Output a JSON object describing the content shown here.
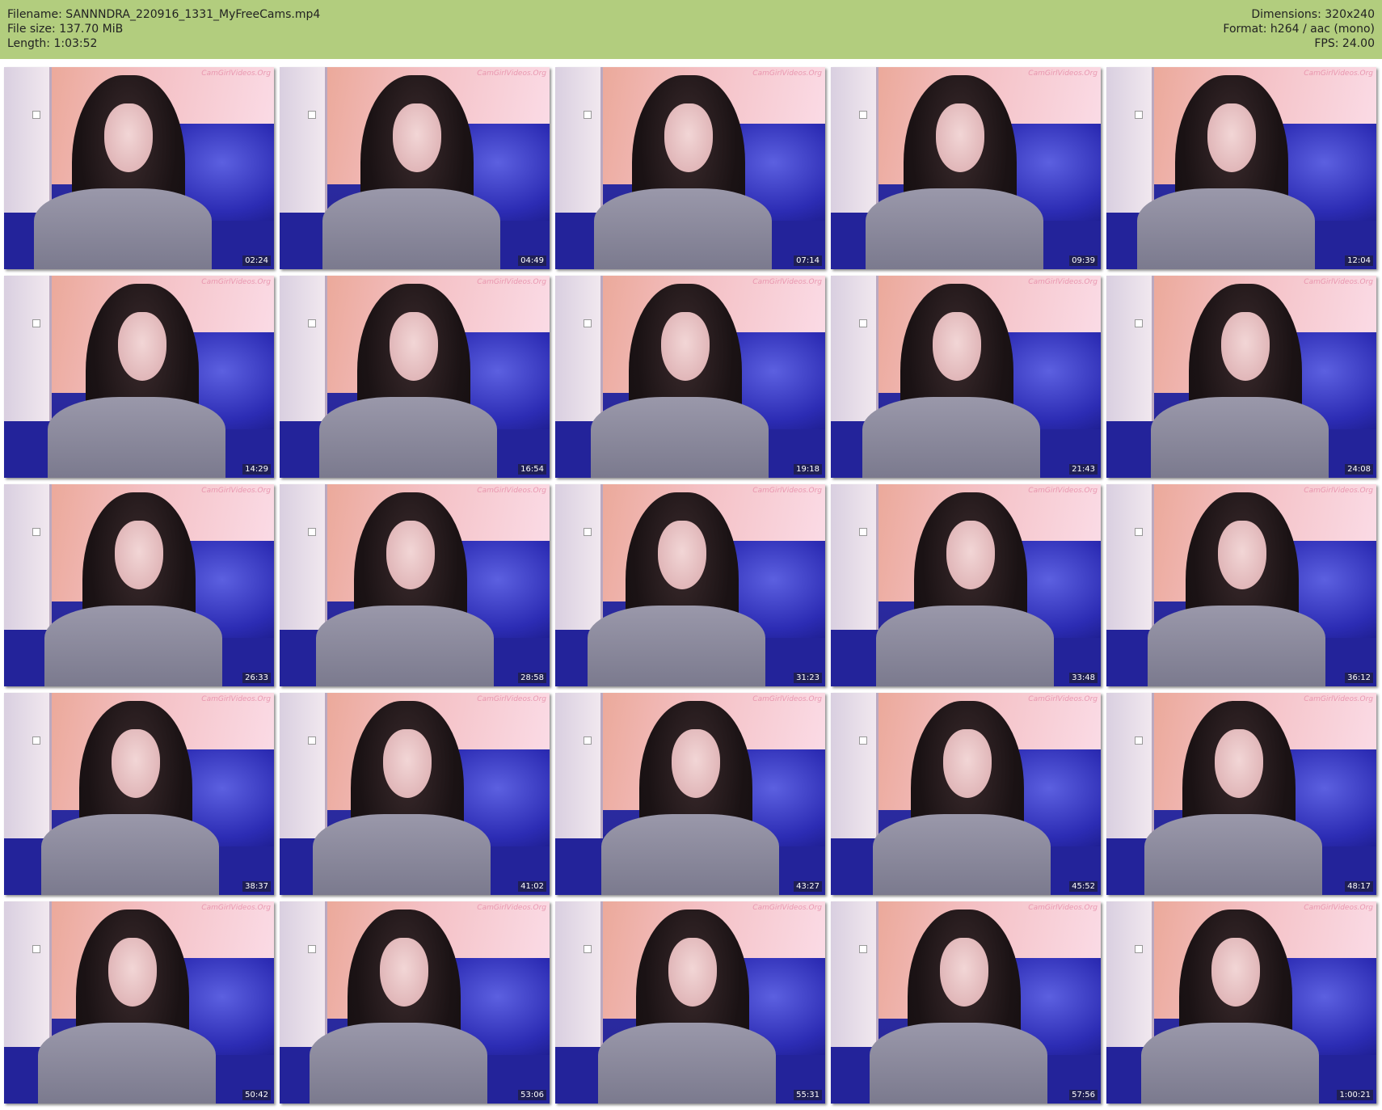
{
  "header": {
    "filename": "Filename: SANNNDRA_220916_1331_MyFreeCams.mp4",
    "filesize": "File size: 137.70 MiB",
    "length": "Length: 1:03:52",
    "dimensions": "Dimensions: 320x240",
    "format": "Format: h264 / aac (mono)",
    "fps": "FPS: 24.00"
  },
  "watermark": "CamGirlVideos.Org",
  "timestamps": [
    "02:24",
    "04:49",
    "07:14",
    "09:39",
    "12:04",
    "14:29",
    "16:54",
    "19:18",
    "21:43",
    "24:08",
    "26:33",
    "28:58",
    "31:23",
    "33:48",
    "36:12",
    "38:37",
    "41:02",
    "43:27",
    "45:52",
    "48:17",
    "50:42",
    "53:06",
    "55:31",
    "57:56",
    "1:00:21"
  ]
}
